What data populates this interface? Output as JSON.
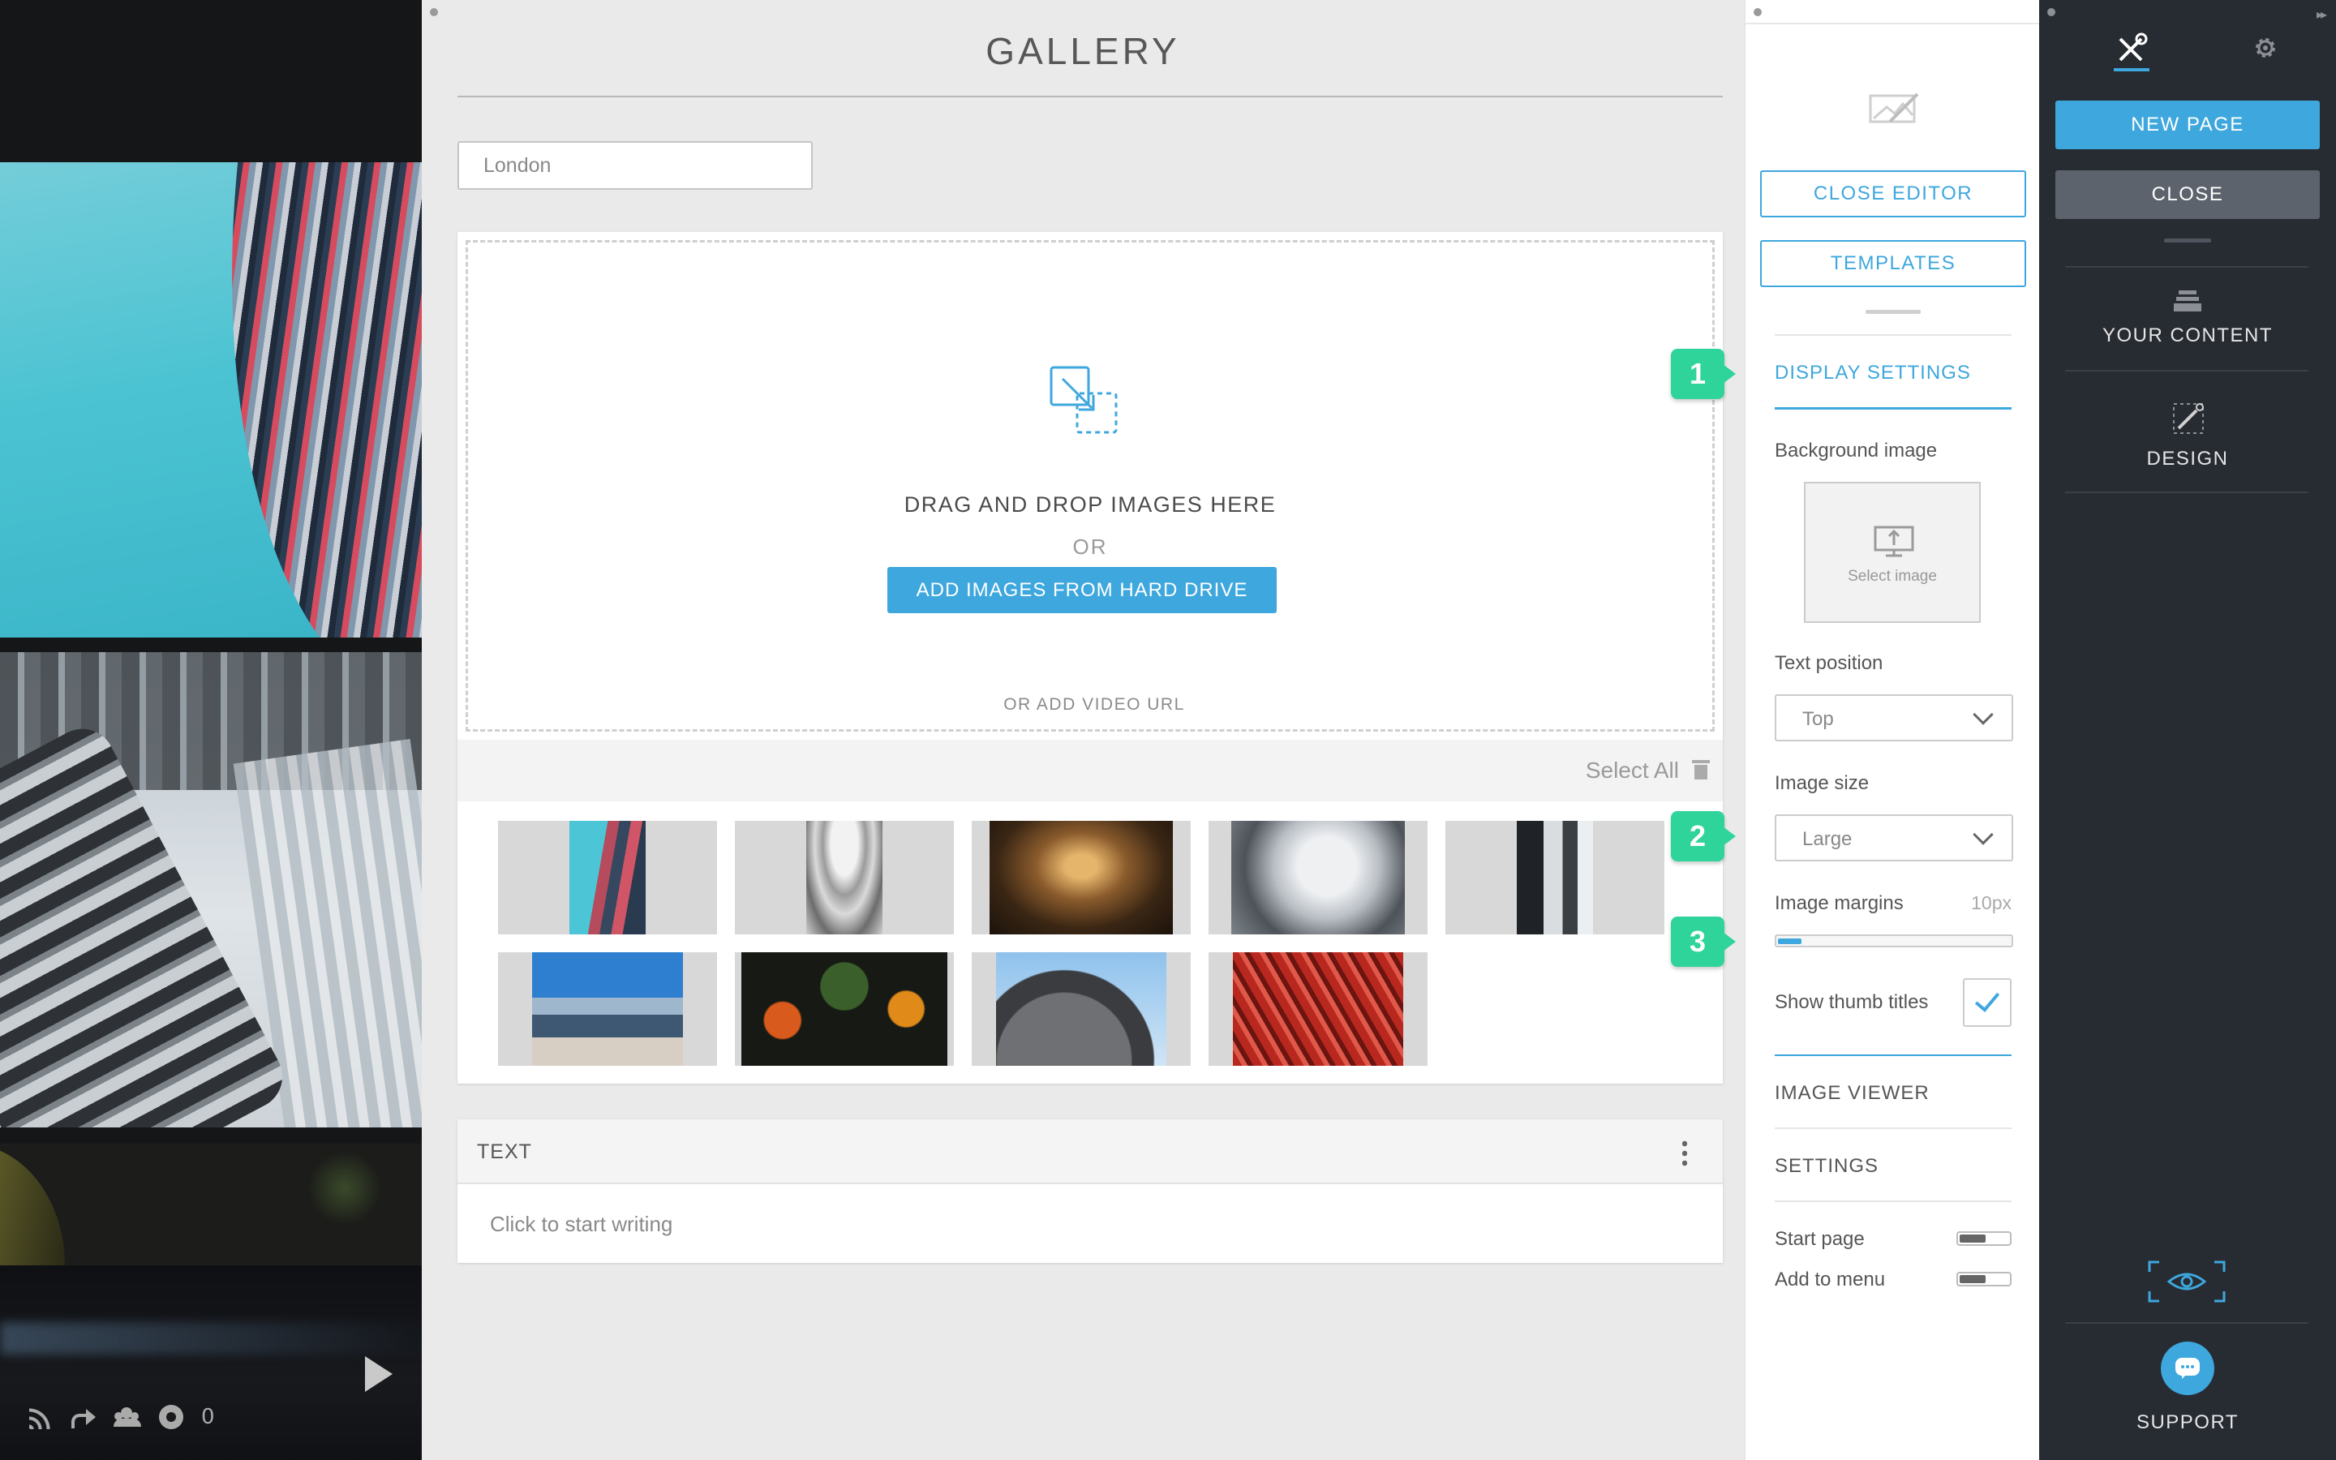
{
  "editor": {
    "title": "GALLERY",
    "location_value": "London",
    "dropzone": {
      "drag_text": "DRAG AND DROP IMAGES HERE",
      "or_text": "OR",
      "add_button": "ADD IMAGES FROM HARD DRIVE",
      "video_url": "OR ADD VIDEO URL"
    },
    "select_all": "Select All",
    "thumbnails": [
      {
        "subject": "curved-building-sky"
      },
      {
        "subject": "museum-atrium"
      },
      {
        "subject": "museum-hall"
      },
      {
        "subject": "skyscrapers-looking-up"
      },
      {
        "subject": "dark-tower"
      },
      {
        "subject": "london-skyline"
      },
      {
        "subject": "autumn-leaves"
      },
      {
        "subject": "geodesic-dome"
      },
      {
        "subject": "red-facade"
      }
    ],
    "text_block": {
      "title": "TEXT",
      "placeholder": "Click to start writing"
    },
    "callouts": [
      "1",
      "2",
      "3"
    ]
  },
  "preview": {
    "like_count": "0"
  },
  "settings": {
    "close_editor": "CLOSE EDITOR",
    "templates": "TEMPLATES",
    "display_settings": "DISPLAY SETTINGS",
    "background_image_label": "Background image",
    "select_image": "Select image",
    "text_position_label": "Text position",
    "text_position_value": "Top",
    "image_size_label": "Image size",
    "image_size_value": "Large",
    "image_margins_label": "Image margins",
    "image_margins_value": "10px",
    "image_margins_fraction": 0.1,
    "show_thumb_titles_label": "Show thumb titles",
    "show_thumb_titles": true,
    "image_viewer": "IMAGE VIEWER",
    "settings_section": "SETTINGS",
    "start_page_label": "Start page",
    "add_to_menu_label": "Add to menu"
  },
  "nav": {
    "new_page": "NEW PAGE",
    "close": "CLOSE",
    "your_content": "YOUR CONTENT",
    "design": "DESIGN",
    "support": "SUPPORT"
  },
  "colors": {
    "accent": "#3ea7dd",
    "callout": "#2fd49a",
    "nav_bg": "#272b32"
  }
}
